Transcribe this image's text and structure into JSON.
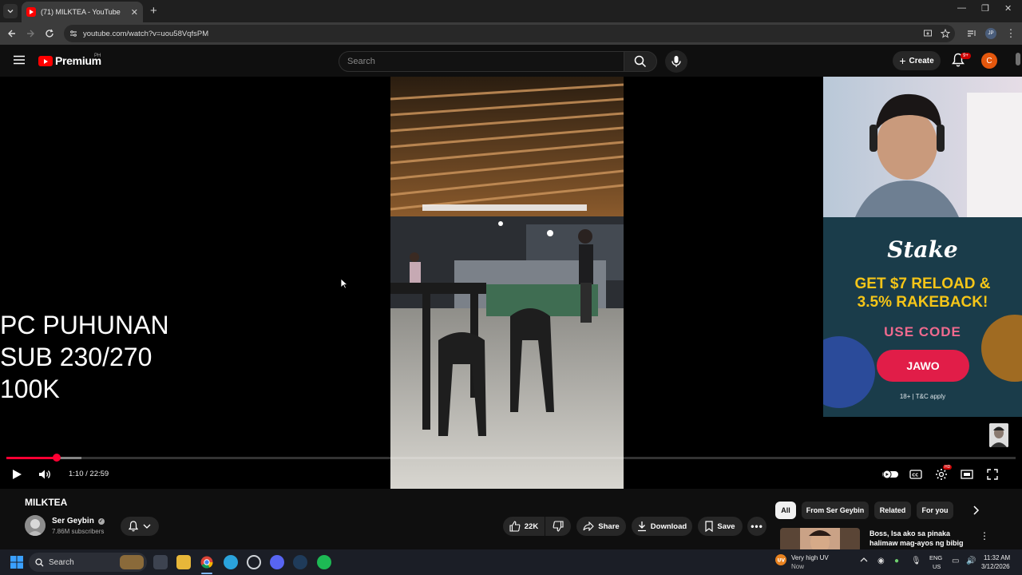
{
  "browser": {
    "tab_title": "(71) MILKTEA - YouTube",
    "url": "youtube.com/watch?v=uou58VqfsPM",
    "profile_initials": "JP"
  },
  "yt": {
    "logo_text": "Premium",
    "logo_region": "PH",
    "search_placeholder": "Search",
    "create_label": "Create",
    "notif_count": "9+",
    "user_initial": "C"
  },
  "player": {
    "overlay_lines": [
      "PC PUHUNAN",
      "SUB 230/270",
      "100K"
    ],
    "time": "1:10 / 22:59",
    "progress_fraction": 0.05
  },
  "ad": {
    "brand": "Stake",
    "headline_line1": "GET $7 RELOAD &",
    "headline_line2": "3.5% RAKEBACK!",
    "use_code": "USE CODE",
    "code": "JAWO",
    "disclaimer": "18+ | T&C apply"
  },
  "video": {
    "title": "MILKTEA",
    "channel": "Ser Geybin",
    "subscribers": "7.86M subscribers",
    "likes": "22K",
    "share": "Share",
    "download": "Download",
    "save": "Save"
  },
  "chips": [
    "All",
    "From Ser Geybin",
    "Related",
    "For you"
  ],
  "recommendation": {
    "title": "Boss, Isa ako sa pinaka halimaw mag-ayos ng bibig"
  },
  "taskbar": {
    "search_label": "Search",
    "weather_line1": "Very high UV",
    "weather_line2": "Now",
    "lang_line1": "ENG",
    "lang_line2": "US",
    "time": "11:32 AM",
    "date": "3/12/2026"
  },
  "colors": {
    "yt_red": "#ff0000",
    "progress": "#ff0033",
    "ad_bg": "#1a3c4a",
    "ad_accent": "#f5c518",
    "ad_button": "#e11d48"
  }
}
